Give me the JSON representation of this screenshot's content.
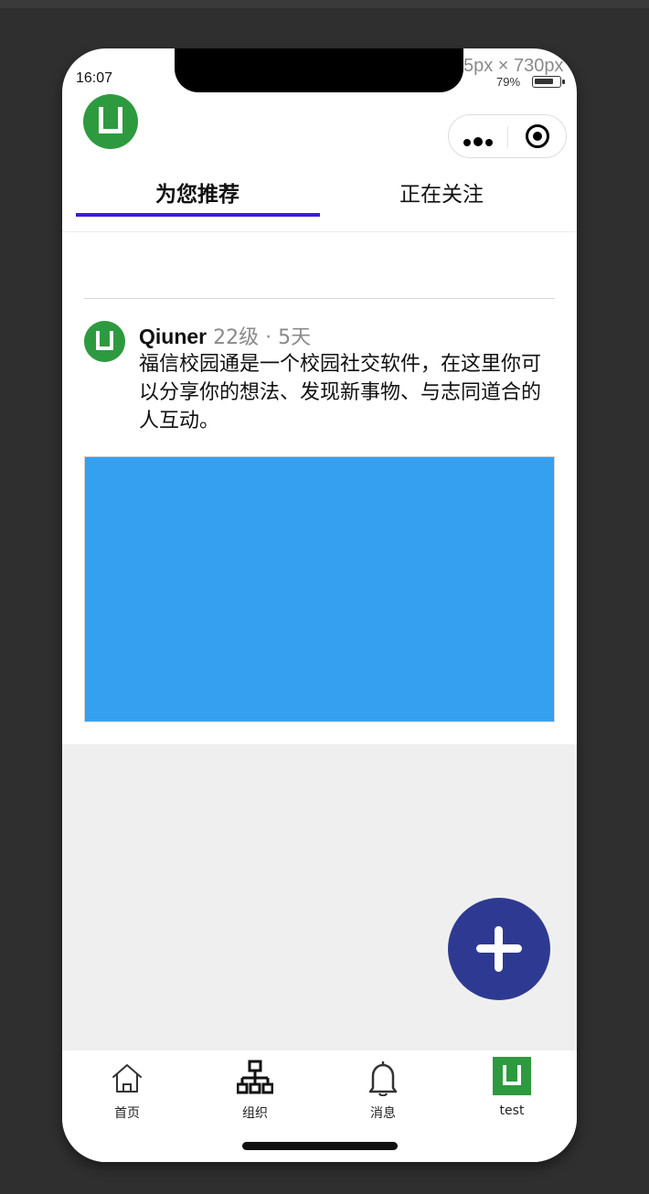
{
  "status_bar": {
    "time": "16:07",
    "dimensions_overlay": "5px × 730px",
    "battery_percent": "79%",
    "battery_level": 0.79
  },
  "header": {
    "logo_icon": "u-logo-icon",
    "menu_icon": "more-dots-icon",
    "close_icon": "target-circle-icon"
  },
  "tabs": [
    {
      "label": "为您推荐",
      "active": true
    },
    {
      "label": "正在关注",
      "active": false
    }
  ],
  "post": {
    "author": "Qiuner",
    "meta": " 22级 · 5天",
    "text": "福信校园通是一个校园社交软件，在这里你可以分享你的想法、发现新事物、与志同道合的人互动。",
    "image_color": "#35a0f0"
  },
  "fab": {
    "icon": "plus-icon",
    "color": "#2e3a91"
  },
  "tabbar": {
    "items": [
      {
        "label": "首页",
        "icon": "home-icon"
      },
      {
        "label": "组织",
        "icon": "org-chart-icon"
      },
      {
        "label": "消息",
        "icon": "bell-icon"
      },
      {
        "label": "test",
        "icon": "avatar-icon"
      }
    ]
  },
  "colors": {
    "brand_green": "#2e9a3f",
    "tab_underline": "#3a1fd6",
    "fab_blue": "#2e3a91",
    "image_blue": "#35a0f0"
  }
}
